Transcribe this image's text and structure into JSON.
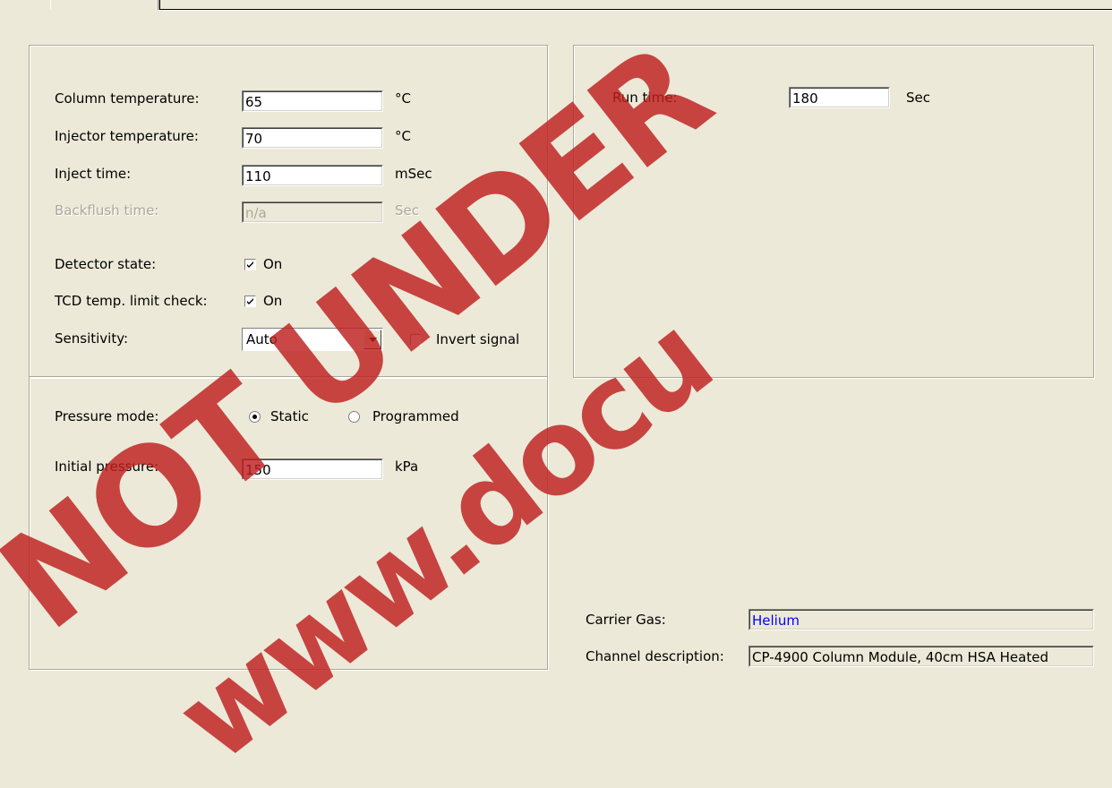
{
  "column_settings": {
    "column_temperature": {
      "label": "Column temperature:",
      "value": "65",
      "unit": "°C"
    },
    "injector_temperature": {
      "label": "Injector temperature:",
      "value": "70",
      "unit": "°C"
    },
    "inject_time": {
      "label": "Inject time:",
      "value": "110",
      "unit": "mSec"
    },
    "backflush_time": {
      "label": "Backflush time:",
      "value": "n/a",
      "unit": "Sec",
      "disabled": true
    },
    "detector_state": {
      "label": "Detector state:",
      "checkbox_label": "On",
      "checked": true
    },
    "tcd_limit_check": {
      "label": "TCD temp. limit check:",
      "checkbox_label": "On",
      "checked": true
    },
    "sensitivity": {
      "label": "Sensitivity:",
      "selected": "Auto"
    },
    "invert_signal": {
      "label": "Invert signal",
      "checked": false
    }
  },
  "pressure": {
    "mode_label": "Pressure mode:",
    "static_label": "Static",
    "programmed_label": "Programmed",
    "selected_mode": "Static",
    "initial_pressure": {
      "label": "Initial pressure:",
      "value": "150",
      "unit": "kPa"
    }
  },
  "run": {
    "run_time": {
      "label": "Run time:",
      "value": "180",
      "unit": "Sec"
    }
  },
  "info": {
    "carrier_gas": {
      "label": "Carrier Gas:",
      "value": "Helium"
    },
    "channel_description": {
      "label": "Channel description:",
      "value": "CP-4900 Column Module, 40cm HSA Heated"
    }
  },
  "watermark": {
    "text1": "NOT UNDER",
    "text2": "www.docu"
  },
  "colors": {
    "background": "#ECE9D8",
    "watermark": "#BE1E1E",
    "carrier_gas_text": "#0000FF"
  }
}
